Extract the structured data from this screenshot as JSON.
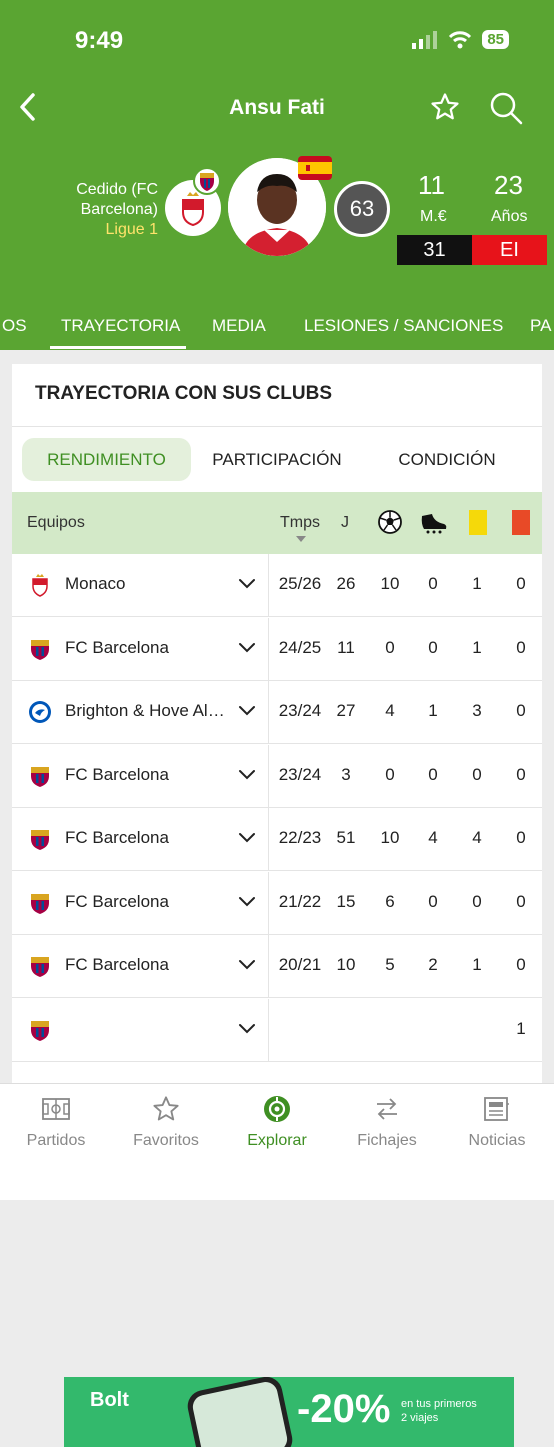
{
  "status_bar": {
    "time": "9:49",
    "battery": "85"
  },
  "header": {
    "title": "Ansu Fati",
    "loan_text_line1": "Cedido (FC",
    "loan_text_line2": "Barcelona)",
    "league": "Ligue 1",
    "rating": "63",
    "stat1_value": "11",
    "stat1_label": "M.€",
    "stat2_value": "23",
    "stat2_label": "Años",
    "box_black": "31",
    "box_red": "EI"
  },
  "tabs": [
    "OS",
    "TRAYECTORIA",
    "MEDIA",
    "LESIONES / SANCIONES",
    "PA"
  ],
  "card": {
    "title": "TRAYECTORIA CON SUS CLUBS",
    "segments": [
      "RENDIMIENTO",
      "PARTICIPACIÓN",
      "CONDICIÓN"
    ],
    "columns": {
      "teams": "Equipos",
      "season": "Tmps",
      "played": "J"
    },
    "rows": [
      {
        "team": "Monaco",
        "crest": "monaco",
        "season": "25/26",
        "j": "26",
        "goals": "10",
        "assists": "0",
        "yellow": "1",
        "red": "0"
      },
      {
        "team": "FC Barcelona",
        "crest": "barcelona",
        "season": "24/25",
        "j": "11",
        "goals": "0",
        "assists": "0",
        "yellow": "1",
        "red": "0"
      },
      {
        "team": "Brighton & Hove Albi...",
        "crest": "brighton",
        "season": "23/24",
        "j": "27",
        "goals": "4",
        "assists": "1",
        "yellow": "3",
        "red": "0"
      },
      {
        "team": "FC Barcelona",
        "crest": "barcelona",
        "season": "23/24",
        "j": "3",
        "goals": "0",
        "assists": "0",
        "yellow": "0",
        "red": "0"
      },
      {
        "team": "FC Barcelona",
        "crest": "barcelona",
        "season": "22/23",
        "j": "51",
        "goals": "10",
        "assists": "4",
        "yellow": "4",
        "red": "0"
      },
      {
        "team": "FC Barcelona",
        "crest": "barcelona",
        "season": "21/22",
        "j": "15",
        "goals": "6",
        "assists": "0",
        "yellow": "0",
        "red": "0"
      },
      {
        "team": "FC Barcelona",
        "crest": "barcelona",
        "season": "20/21",
        "j": "10",
        "goals": "5",
        "assists": "2",
        "yellow": "1",
        "red": "0"
      },
      {
        "team": "",
        "crest": "barcelona",
        "season": "",
        "j": "",
        "goals": "",
        "assists": "",
        "yellow": "",
        "red": "1"
      }
    ]
  },
  "ad": {
    "brand": "Bolt",
    "discount": "-20%",
    "text_line1": "en tus primeros",
    "text_line2": "2 viajes"
  },
  "bottom_nav": [
    {
      "label": "Partidos",
      "icon": "pitch-icon"
    },
    {
      "label": "Favoritos",
      "icon": "star-icon"
    },
    {
      "label": "Explorar",
      "icon": "compass-icon"
    },
    {
      "label": "Fichajes",
      "icon": "transfer-icon"
    },
    {
      "label": "Noticias",
      "icon": "news-icon"
    }
  ],
  "colors": {
    "brand_green": "#5aa532",
    "active_green": "#3f8f23",
    "red": "#e7131a",
    "yellow": "#f5d90a"
  }
}
